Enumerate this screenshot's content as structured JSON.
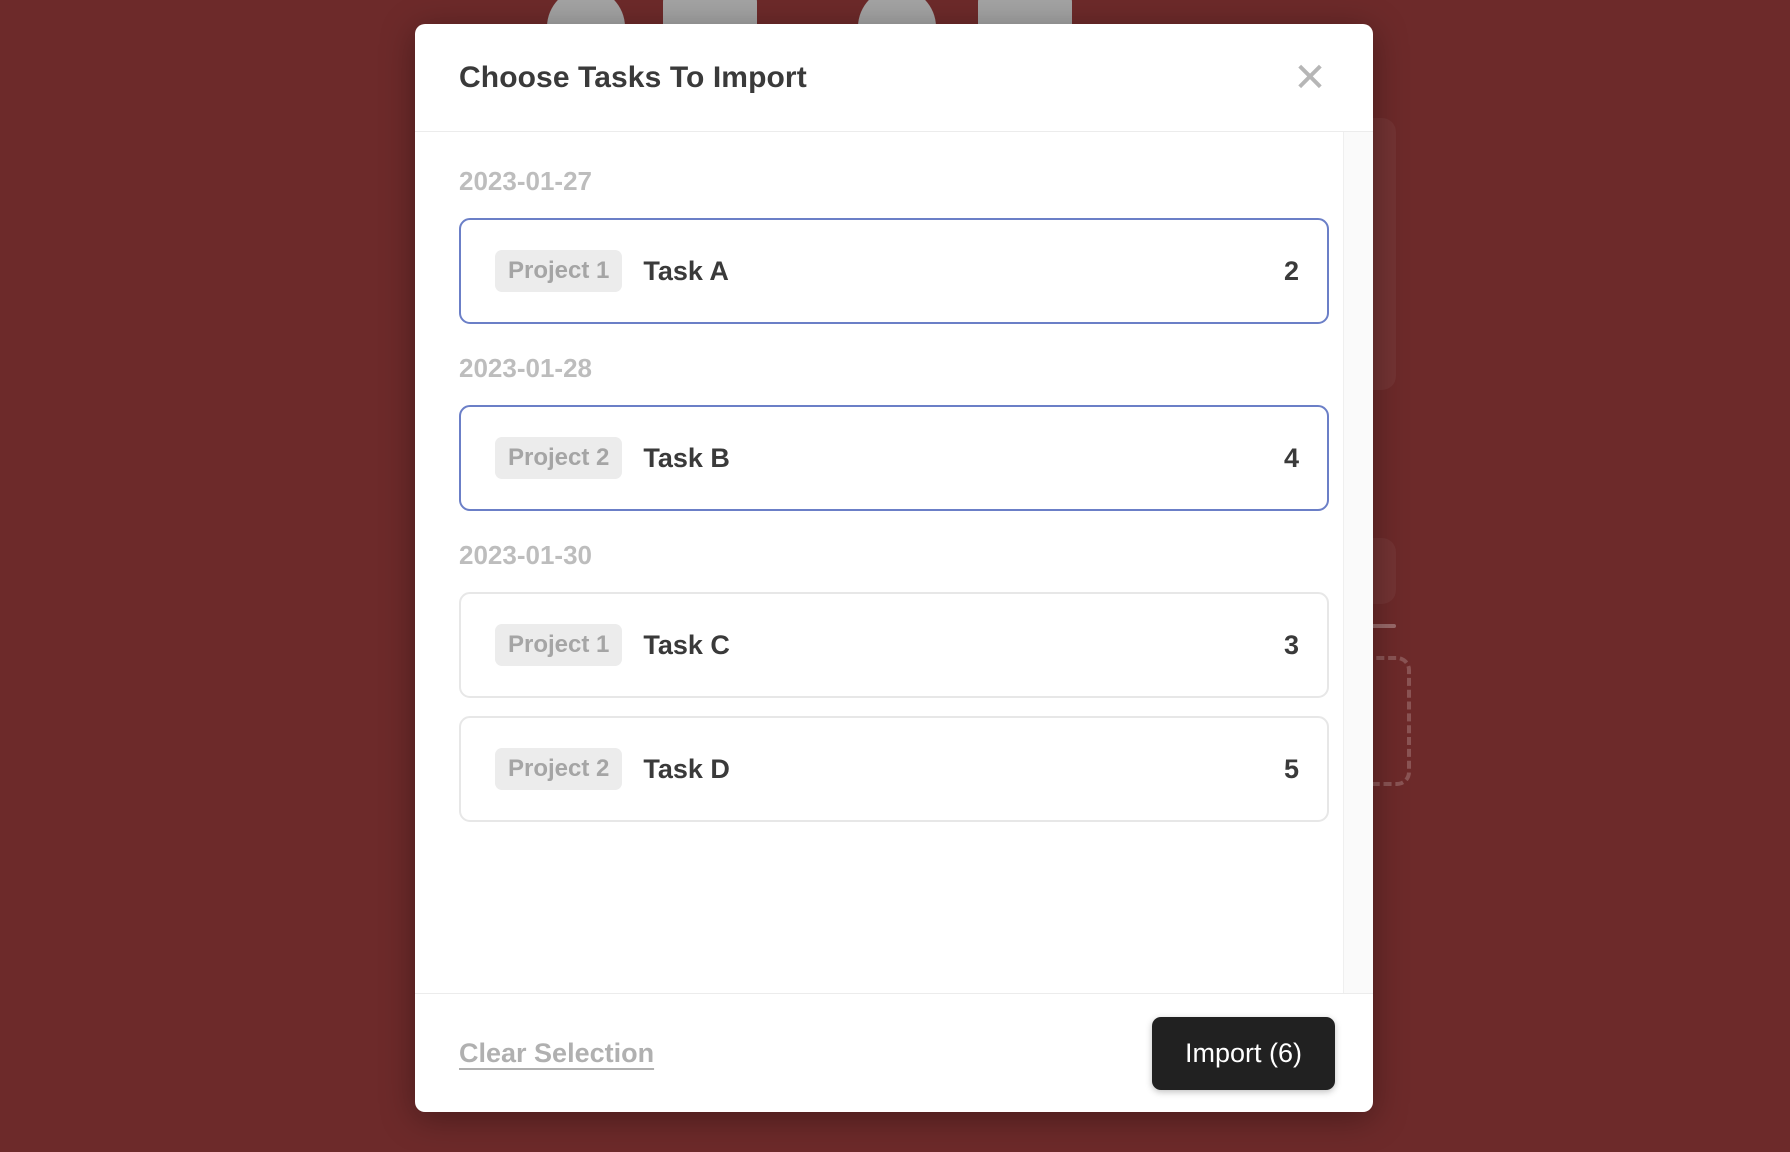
{
  "background": {
    "color": "#6d2a2a",
    "shape_color": "#a3a3a3"
  },
  "modal": {
    "title": "Choose Tasks To Import",
    "close_icon_label": "✕",
    "groups": [
      {
        "date": "2023-01-27",
        "tasks": [
          {
            "project": "Project 1",
            "name": "Task A",
            "value": "2",
            "selected": true
          }
        ]
      },
      {
        "date": "2023-01-28",
        "tasks": [
          {
            "project": "Project 2",
            "name": "Task B",
            "value": "4",
            "selected": true
          }
        ]
      },
      {
        "date": "2023-01-30",
        "tasks": [
          {
            "project": "Project 1",
            "name": "Task C",
            "value": "3",
            "selected": false
          },
          {
            "project": "Project 2",
            "name": "Task D",
            "value": "5",
            "selected": false
          }
        ]
      }
    ],
    "footer": {
      "clear_label": "Clear Selection",
      "import_label": "Import (6)"
    },
    "colors": {
      "selected_border": "#6b7fc7",
      "unselected_border": "#e7e7e7",
      "badge_bg": "#ececec",
      "badge_text": "#a5a5a5",
      "primary_button_bg": "#212121",
      "primary_button_text": "#ffffff",
      "date_label": "#bdbdbd"
    }
  }
}
